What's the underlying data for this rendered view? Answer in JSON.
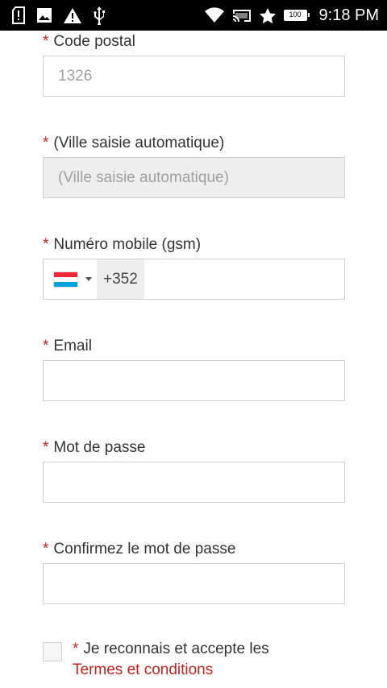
{
  "status_bar": {
    "time": "9:18 PM",
    "battery": "100",
    "icons": [
      "sd-card-icon",
      "image-icon",
      "warning-icon",
      "usb-icon",
      "wifi-icon",
      "cast-icon",
      "star-icon",
      "battery-icon"
    ]
  },
  "form": {
    "postal": {
      "required": "*",
      "label": "Code postal",
      "placeholder": "1326"
    },
    "city": {
      "required": "*",
      "label": "(Ville saisie automatique)",
      "placeholder": "(Ville saisie automatique)"
    },
    "mobile": {
      "required": "*",
      "label": "Numéro mobile (gsm)",
      "country_flag": "luxembourg-flag-icon",
      "dial_code": "+352",
      "value": ""
    },
    "email": {
      "required": "*",
      "label": "Email",
      "value": ""
    },
    "password": {
      "required": "*",
      "label": "Mot de passe",
      "value": ""
    },
    "confirm_password": {
      "required": "*",
      "label": "Confirmez le mot de passe",
      "value": ""
    },
    "terms": {
      "required": "*",
      "text": "Je reconnais et accepte les",
      "link": "Termes et conditions",
      "checked": false
    }
  },
  "colors": {
    "required": "#cc1f1f",
    "link": "#c8201f",
    "border": "#cfcfcf",
    "disabled_bg": "#eeeeee"
  }
}
